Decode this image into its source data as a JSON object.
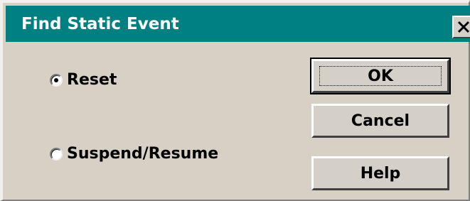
{
  "window": {
    "title": "Find Static Event",
    "close_icon": "close-icon"
  },
  "options": {
    "reset_label": "Reset",
    "reset_selected": true,
    "suspend_label": "Suspend/Resume",
    "suspend_selected": false
  },
  "buttons": {
    "ok_label": "OK",
    "cancel_label": "Cancel",
    "help_label": "Help"
  },
  "colors": {
    "titlebar": "#008080",
    "face": "#d6d0c5"
  }
}
